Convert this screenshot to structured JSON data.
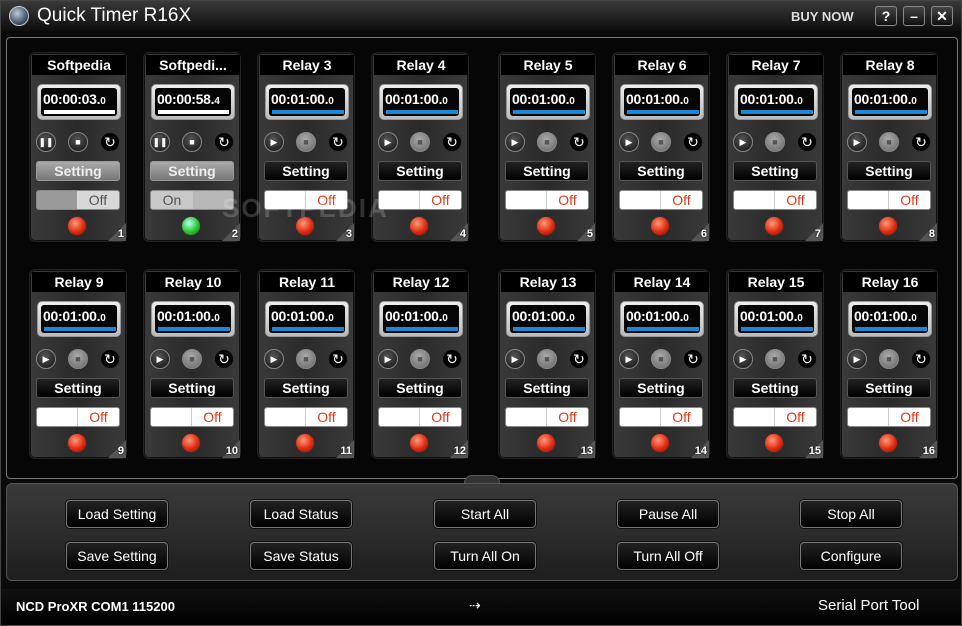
{
  "window": {
    "title": "Quick Timer R16X",
    "buy_now": "BUY NOW",
    "help": "?",
    "minimize": "–",
    "close": "✕"
  },
  "watermark": "SOFTPEDIA",
  "relays": [
    {
      "title": "Softpedia",
      "time": "00:00:03.",
      "tenths": "0",
      "progress": 0.99,
      "bar_color": "#ffffff",
      "controls": [
        "pause",
        "stop",
        "reset"
      ],
      "setting": "Setting",
      "setting_style": "light",
      "switch": "Off",
      "switch_state": "off-gray",
      "led": "red",
      "number": "1"
    },
    {
      "title": "Softpedi...",
      "time": "00:00:58.",
      "tenths": "4",
      "progress": 0.99,
      "bar_color": "#ffffff",
      "controls": [
        "pause",
        "stop",
        "reset"
      ],
      "setting": "Setting",
      "setting_style": "light",
      "switch": "On",
      "switch_state": "on-gray",
      "led": "green",
      "number": "2"
    },
    {
      "title": "Relay 3",
      "time": "00:01:00.",
      "tenths": "0",
      "progress": 1,
      "bar_color": "#1a88d8",
      "controls": [
        "play",
        "stop",
        "reset"
      ],
      "setting": "Setting",
      "setting_style": "dark",
      "switch": "Off",
      "switch_state": "off",
      "led": "red",
      "number": "3"
    },
    {
      "title": "Relay 4",
      "time": "00:01:00.",
      "tenths": "0",
      "progress": 1,
      "bar_color": "#1a88d8",
      "controls": [
        "play",
        "stop",
        "reset"
      ],
      "setting": "Setting",
      "setting_style": "dark",
      "switch": "Off",
      "switch_state": "off",
      "led": "red",
      "number": "4"
    },
    {
      "title": "Relay 5",
      "time": "00:01:00.",
      "tenths": "0",
      "progress": 1,
      "bar_color": "#1a88d8",
      "controls": [
        "play",
        "stop",
        "reset"
      ],
      "setting": "Setting",
      "setting_style": "dark",
      "switch": "Off",
      "switch_state": "off",
      "led": "red",
      "number": "5"
    },
    {
      "title": "Relay 6",
      "time": "00:01:00.",
      "tenths": "0",
      "progress": 1,
      "bar_color": "#1a88d8",
      "controls": [
        "play",
        "stop",
        "reset"
      ],
      "setting": "Setting",
      "setting_style": "dark",
      "switch": "Off",
      "switch_state": "off",
      "led": "red",
      "number": "6"
    },
    {
      "title": "Relay 7",
      "time": "00:01:00.",
      "tenths": "0",
      "progress": 1,
      "bar_color": "#1a88d8",
      "controls": [
        "play",
        "stop",
        "reset"
      ],
      "setting": "Setting",
      "setting_style": "dark",
      "switch": "Off",
      "switch_state": "off",
      "led": "red",
      "number": "7"
    },
    {
      "title": "Relay 8",
      "time": "00:01:00.",
      "tenths": "0",
      "progress": 1,
      "bar_color": "#1a88d8",
      "controls": [
        "play",
        "stop",
        "reset"
      ],
      "setting": "Setting",
      "setting_style": "dark",
      "switch": "Off",
      "switch_state": "off",
      "led": "red",
      "number": "8"
    },
    {
      "title": "Relay 9",
      "time": "00:01:00.",
      "tenths": "0",
      "progress": 1,
      "bar_color": "#1a88d8",
      "controls": [
        "play",
        "stop",
        "reset"
      ],
      "setting": "Setting",
      "setting_style": "dark",
      "switch": "Off",
      "switch_state": "off",
      "led": "red",
      "number": "9"
    },
    {
      "title": "Relay 10",
      "time": "00:01:00.",
      "tenths": "0",
      "progress": 1,
      "bar_color": "#1a88d8",
      "controls": [
        "play",
        "stop",
        "reset"
      ],
      "setting": "Setting",
      "setting_style": "dark",
      "switch": "Off",
      "switch_state": "off",
      "led": "red",
      "number": "10"
    },
    {
      "title": "Relay 11",
      "time": "00:01:00.",
      "tenths": "0",
      "progress": 1,
      "bar_color": "#1a88d8",
      "controls": [
        "play",
        "stop",
        "reset"
      ],
      "setting": "Setting",
      "setting_style": "dark",
      "switch": "Off",
      "switch_state": "off",
      "led": "red",
      "number": "11"
    },
    {
      "title": "Relay 12",
      "time": "00:01:00.",
      "tenths": "0",
      "progress": 1,
      "bar_color": "#1a88d8",
      "controls": [
        "play",
        "stop",
        "reset"
      ],
      "setting": "Setting",
      "setting_style": "dark",
      "switch": "Off",
      "switch_state": "off",
      "led": "red",
      "number": "12"
    },
    {
      "title": "Relay 13",
      "time": "00:01:00.",
      "tenths": "0",
      "progress": 1,
      "bar_color": "#1a88d8",
      "controls": [
        "play",
        "stop",
        "reset"
      ],
      "setting": "Setting",
      "setting_style": "dark",
      "switch": "Off",
      "switch_state": "off",
      "led": "red",
      "number": "13"
    },
    {
      "title": "Relay 14",
      "time": "00:01:00.",
      "tenths": "0",
      "progress": 1,
      "bar_color": "#1a88d8",
      "controls": [
        "play",
        "stop",
        "reset"
      ],
      "setting": "Setting",
      "setting_style": "dark",
      "switch": "Off",
      "switch_state": "off",
      "led": "red",
      "number": "14"
    },
    {
      "title": "Relay 15",
      "time": "00:01:00.",
      "tenths": "0",
      "progress": 1,
      "bar_color": "#1a88d8",
      "controls": [
        "play",
        "stop",
        "reset"
      ],
      "setting": "Setting",
      "setting_style": "dark",
      "switch": "Off",
      "switch_state": "off",
      "led": "red",
      "number": "15"
    },
    {
      "title": "Relay 16",
      "time": "00:01:00.",
      "tenths": "0",
      "progress": 1,
      "bar_color": "#1a88d8",
      "controls": [
        "play",
        "stop",
        "reset"
      ],
      "setting": "Setting",
      "setting_style": "dark",
      "switch": "Off",
      "switch_state": "off",
      "led": "red",
      "number": "16"
    }
  ],
  "buttons": {
    "load_setting": "Load Setting",
    "save_setting": "Save Setting",
    "load_status": "Load Status",
    "save_status": "Save Status",
    "start_all": "Start All",
    "turn_all_on": "Turn All On",
    "pause_all": "Pause All",
    "turn_all_off": "Turn All Off",
    "stop_all": "Stop All",
    "configure": "Configure"
  },
  "status": {
    "connection": "NCD ProXR COM1 115200",
    "arrow": "⇢",
    "tool": "Serial Port Tool"
  },
  "colors": {
    "led_red": "#e02a10",
    "led_green": "#33cc33",
    "progress_blue": "#1a88d8",
    "off_text": "#e03a1a"
  }
}
